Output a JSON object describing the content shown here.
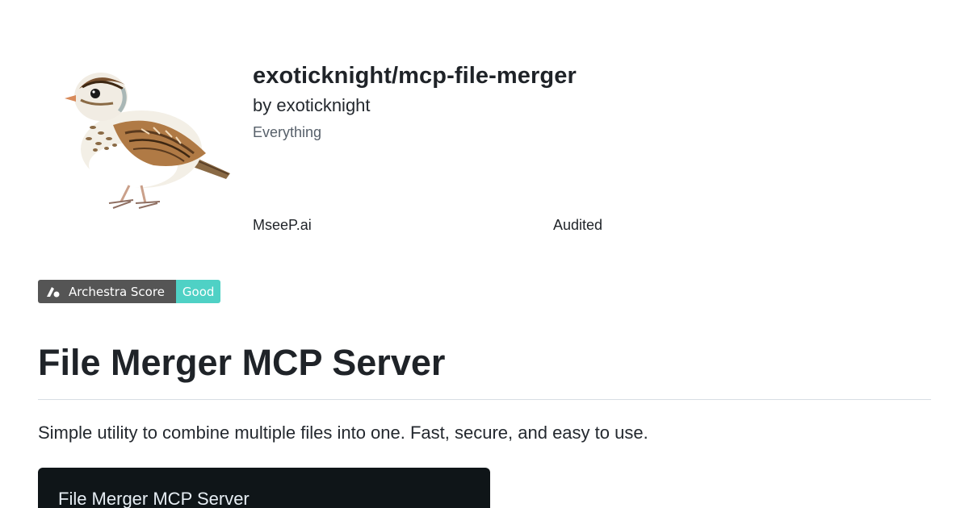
{
  "repo": {
    "name": "exoticknight/mcp-file-merger",
    "author": "by exoticknight",
    "category": "Everything"
  },
  "badges": {
    "mseep": "MseeP.ai",
    "audited": "Audited"
  },
  "score_badge": {
    "label": "Archestra Score",
    "value": "Good",
    "label_color": "#555555",
    "value_color": "#4fd1c5"
  },
  "readme": {
    "title": "File Merger MCP Server",
    "description": "Simple utility to combine multiple files into one. Fast, secure, and easy to use.",
    "code_block_text": "File Merger MCP Server"
  },
  "icons": {
    "avatar": "sparrow-bird-illustration",
    "score_logo": "archestra-logo-icon"
  }
}
